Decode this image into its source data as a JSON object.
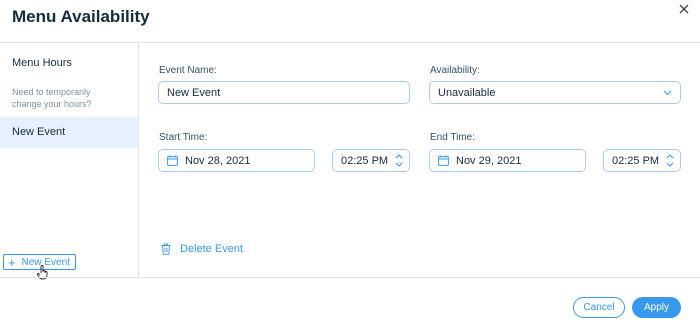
{
  "dialog": {
    "title": "Menu Availability"
  },
  "sidebar": {
    "items": [
      {
        "label": "Menu Hours"
      },
      {
        "label": "Need to temporarily change your hours?"
      },
      {
        "label": "New Event"
      }
    ],
    "new_event_button": "New Event"
  },
  "form": {
    "event_name": {
      "label": "Event Name:",
      "value": "New Event"
    },
    "availability": {
      "label": "Availability:",
      "value": "Unavailable"
    },
    "start": {
      "label": "Start Time:",
      "date": "Nov 28, 2021",
      "time": "02:25  PM"
    },
    "end": {
      "label": "End Time:",
      "date": "Nov 29, 2021",
      "time": "02:25  PM"
    },
    "delete_label": "Delete Event"
  },
  "footer": {
    "cancel": "Cancel",
    "apply": "Apply"
  },
  "colors": {
    "accent": "#3899ec",
    "selected_bg": "#e7f0ff",
    "border": "#a8caee"
  },
  "icons": [
    "close-icon",
    "calendar-icon",
    "chevron-down-icon",
    "time-stepper-icon",
    "trash-icon",
    "plus-icon",
    "hand-cursor-icon"
  ]
}
